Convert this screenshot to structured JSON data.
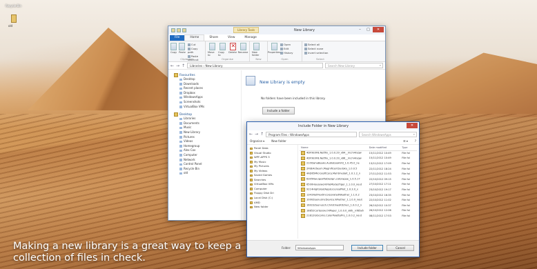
{
  "desktop": {
    "corner_title": "Recycle Bin",
    "icon_label": "old"
  },
  "explorer": {
    "ribbon_context_tab": "Library Tools",
    "title": "New Library",
    "window_controls": [
      "–",
      "□",
      "✕"
    ],
    "tabs": [
      "File",
      "Home",
      "Share",
      "View",
      "Manage"
    ],
    "ribbon_groups": [
      {
        "label": "Clipboard",
        "buttons": [
          "Copy",
          "Paste"
        ],
        "small": [
          "Cut",
          "Copy path",
          "Paste shortcut"
        ]
      },
      {
        "label": "Organise",
        "buttons": [
          "Move to",
          "Copy to",
          "Delete",
          "Rename"
        ],
        "small": []
      },
      {
        "label": "New",
        "buttons": [
          "New folder"
        ],
        "small": []
      },
      {
        "label": "Open",
        "buttons": [
          "Properties"
        ],
        "small": [
          "Open",
          "Edit",
          "History"
        ]
      },
      {
        "label": "Select",
        "buttons": [],
        "small": [
          "Select all",
          "Select none",
          "Invert selection"
        ]
      }
    ],
    "address": "Libraries › New Library",
    "search_placeholder": "Search New Library",
    "nav": {
      "favourites": {
        "head": "Favourites",
        "items": [
          "Desktop",
          "Downloads",
          "Recent places",
          "Dropbox",
          "WindowsApps",
          "Screenshots",
          "VirtualBox VMs"
        ]
      },
      "desktop": {
        "head": "Desktop",
        "items": [
          "Libraries",
          "Documents",
          "Music",
          "New Library",
          "Pictures",
          "Videos",
          "Homegroup",
          "Alex Cox",
          "Computer",
          "Network",
          "Control Panel",
          "Recycle Bin",
          "old"
        ]
      }
    },
    "content": {
      "title": "New Library is empty",
      "message": "No folders have been included in this library.",
      "include_button": "Include a folder"
    }
  },
  "dialog": {
    "title": "Include Folder in New Library",
    "address": "Program Files › WindowsApps",
    "search_placeholder": "Search WindowsApps",
    "toolbar": {
      "organise": "Organise ▾",
      "new_folder": "New folder"
    },
    "nav_rows": [
      "Panel Data",
      "Visual Studio",
      "WPF-APPS 3",
      "My Music",
      "My Pictures",
      "My Videos",
      "Saved Games",
      "Searches",
      "VirtualBox VMs",
      "Computer",
      "Floppy Disk Dri",
      "Local Disk (C:)",
      "AMD",
      "New folder"
    ],
    "columns": [
      "Name",
      "Date modified",
      "Type"
    ],
    "rows": [
      {
        "name": "4DF9E0F8.Netflix_1.0.0.29_x64__mcm4njqw",
        "date": "15/11/2012 10:49",
        "type": "File fol"
      },
      {
        "name": "4DF9E0F8.Netflix_1.0.0.29_x86__mcm4njqw",
        "date": "15/11/2012 10:49",
        "type": "File fol"
      },
      {
        "name": "21ODahaBeakx.AudiobookVld_1.0.45.0_ne",
        "date": "13/11/2012 17:09",
        "type": "File fol"
      },
      {
        "name": "2FBE4c6eum.MagnificentSudoku_1.0.0.5",
        "date": "22/11/2012 18:24",
        "type": "File fol"
      },
      {
        "name": "4AD65MicrosoftCorp.Mahtmedalt_1.0.1.2_n",
        "date": "27/11/2012 11:53",
        "type": "File fol"
      },
      {
        "name": "6305Nav.igosftoDesign.cotorappe_1.0.5.17",
        "date": "22/10/2012 09:15",
        "type": "File fol"
      },
      {
        "name": "6500HouseworkFileModesTiger_1.1.0.0_neut",
        "date": "27/10/2012 17:11",
        "type": "File fol"
      },
      {
        "name": "9214HighSlootAppsLicensePilot_1.0.3.0_x",
        "date": "23/10/2012 19:17",
        "type": "File fol"
      },
      {
        "name": "1341NetFlextIncorporatedWeather_1.1.0.2",
        "date": "23/10/2012 16:35",
        "type": "File fol"
      },
      {
        "name": "1000ZeenusIncDevice.Whether_1.1.0.0_neut",
        "date": "22/10/2012 11:02",
        "type": "File fol"
      },
      {
        "name": "16023Zeenusch.ChristmasKitchen_1.0.0.2_n",
        "date": "26/10/2012 10:37",
        "type": "File fol"
      },
      {
        "name": "18852Cortexsw.OilPaper_1.0.0.0_x86__kf85y6",
        "date": "26/10/2012 12:06",
        "type": "File fol"
      },
      {
        "name": "21812Gibcoms.ColorPalettePro_1.0.0.2_neut",
        "date": "08/11/2012 17:53",
        "type": "File fol"
      }
    ],
    "folder_label": "Folder:",
    "folder_value": "WindowsApps",
    "include_button": "Include folder",
    "cancel_button": "Cancel"
  },
  "caption": "Making a new library is a great way to keep a collection of files in check."
}
